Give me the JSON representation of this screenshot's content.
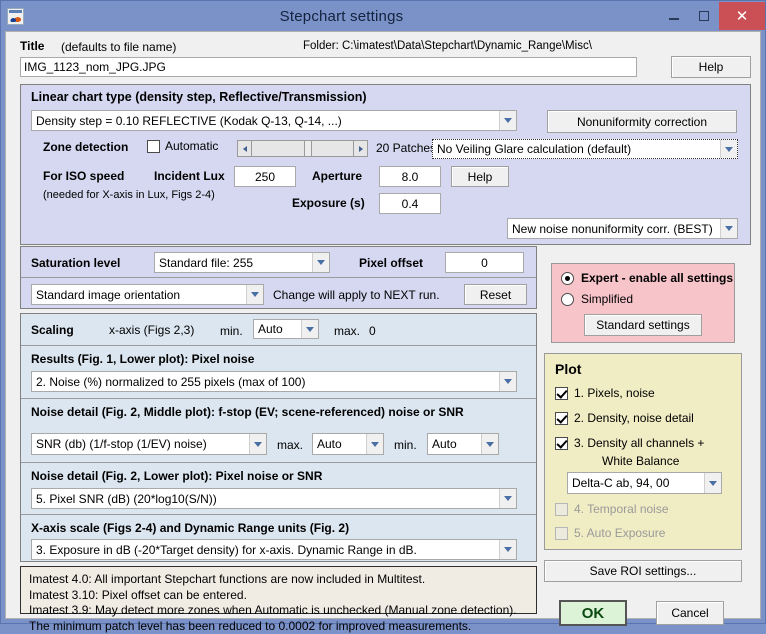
{
  "window": {
    "title": "Stepchart settings",
    "app_icon": "matlab-icon",
    "minimize": "minimize-icon",
    "maximize": "maximize-icon",
    "close": "✕"
  },
  "header": {
    "title_label": "Title",
    "title_hint": "(defaults to file name)",
    "folder_label": "Folder: C:\\imatest\\Data\\Stepchart\\Dynamic_Range\\Misc\\",
    "title_value": "IMG_1123_nom_JPG.JPG",
    "help_label": "Help"
  },
  "linear_chart": {
    "heading": "Linear chart type (density step, Reflective/Transmission)",
    "chart_type_value": "Density step = 0.10  REFLECTIVE          (Kodak Q-13, Q-14, ...)",
    "nonuniformity_button": "Nonuniformity correction",
    "zone_detection_label": "Zone detection",
    "automatic_label": "Automatic",
    "automatic_checked": false,
    "patches_label": "20 Patches",
    "veiling_glare_value": "No Veiling Glare calculation  (default)",
    "iso_label": "For ISO speed",
    "iso_sub_label": "(needed for X-axis in Lux, Figs 2-4)",
    "incident_lux_label": "Incident Lux",
    "incident_lux_value": "250",
    "aperture_label": "Aperture",
    "aperture_value": "8.0",
    "exposure_label": "Exposure (s)",
    "exposure_value": "0.4",
    "help_label": "Help",
    "noise_nonuniformity_value": "New noise nonuniformity corr. (BEST)"
  },
  "saturation": {
    "saturation_label": "Saturation level",
    "standard_file_value": "Standard file: 255",
    "pixel_offset_label": "Pixel offset",
    "pixel_offset_value": "0",
    "orientation_value": "Standard image orientation",
    "change_note": "Change will apply to NEXT run.",
    "reset_label": "Reset"
  },
  "scaling": {
    "heading": "Scaling",
    "xaxis_label": "x-axis (Figs 2,3)",
    "min_label": "min.",
    "min_value": "Auto",
    "max_label": "max.",
    "max_value": "0",
    "results_heading": "Results (Fig. 1, Lower plot):   Pixel noise",
    "results_value": "2. Noise (%) normalized to 255 pixels (max of 100)",
    "middle_heading": "Noise detail (Fig. 2, Middle plot):  f-stop (EV; scene-referenced) noise or SNR",
    "middle_value": "SNR (db) (1/f-stop (1/EV) noise)",
    "middle_max_label": "max.",
    "middle_max_value": "Auto",
    "middle_min_label": "min.",
    "middle_min_value": "Auto",
    "lower_heading": "Noise detail (Fig. 2, Lower plot):  Pixel noise or SNR",
    "lower_value": "5. Pixel SNR (dB)  (20*log10(S/N))",
    "xaxis_heading": "X-axis scale (Figs 2-4) and Dynamic Range units (Fig. 2)",
    "xaxis_value": "3. Exposure in dB (-20*Target density) for x-axis.   Dynamic Range in dB."
  },
  "mode": {
    "expert_label": "Expert - enable all settings",
    "expert_selected": true,
    "simplified_label": "Simplified",
    "simplified_selected": false,
    "standard_settings_label": "Standard settings"
  },
  "plot": {
    "heading": "Plot",
    "items": [
      {
        "label": "1. Pixels, noise",
        "checked": true,
        "enabled": true
      },
      {
        "label": "2. Density, noise detail",
        "checked": true,
        "enabled": true
      },
      {
        "label": "3. Density all channels +",
        "checked": true,
        "enabled": true
      },
      {
        "label": "4. Temporal noise",
        "checked": false,
        "enabled": false
      },
      {
        "label": "5. Auto Exposure",
        "checked": false,
        "enabled": false
      }
    ],
    "white_balance_label": "White Balance",
    "delta_c_value": "Delta-C ab, 94, 00"
  },
  "footer": {
    "save_roi_label": "Save ROI settings...",
    "ok_label": "OK",
    "cancel_label": "Cancel"
  },
  "notes": {
    "line1": "Imatest 4.0: All important Stepchart functions are now included in Multitest.",
    "line2": "Imatest 3.10:  Pixel offset can be entered.",
    "line3": "Imatest 3.9:  May detect more zones when Automatic is unchecked (Manual zone detection).",
    "line4": "The minimum patch level has been reduced to 0.0002 for improved measurements."
  },
  "colors": {
    "titlebar": "#7b92c8",
    "close_button": "#cb5055",
    "panel_lavender": "#d5d8f0",
    "panel_blue": "#dce6f0",
    "panel_pink": "#f7c4ca",
    "panel_yellow": "#f0ecc4",
    "ok_button": "#ddf3d8"
  }
}
